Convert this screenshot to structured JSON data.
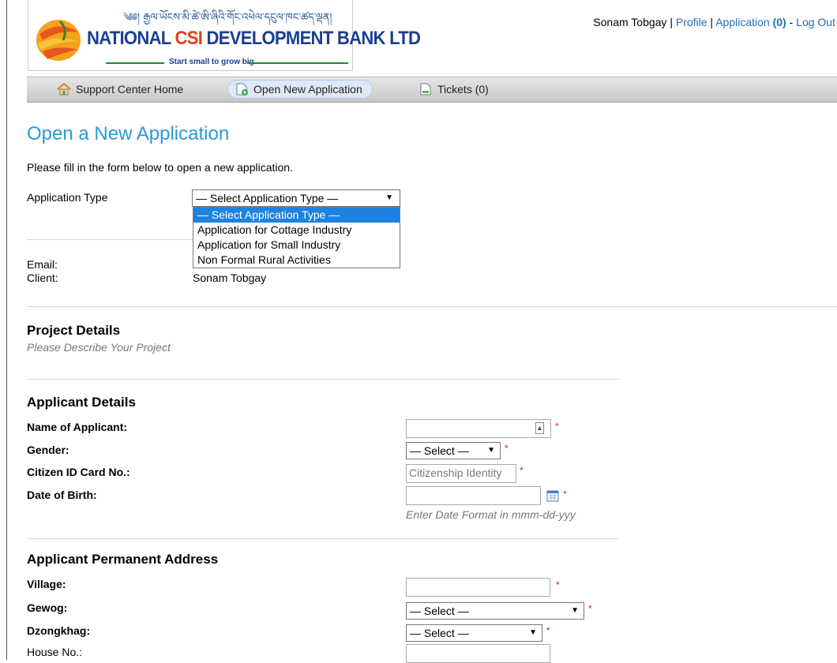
{
  "header": {
    "logo_tibetan": "༄༅། རྒྱལ་ཡོངས་མི་ཚེ་ཨི་ཞིའི་གོང་འཕེལ་དངུལ་ཁང་ཚད་ལྡན།",
    "logo_name_part1": "NATIONAL ",
    "logo_name_csi": "CSI",
    "logo_name_part2": " DEVELOPMENT BANK LTD",
    "logo_tagline": "Start small to grow big",
    "user_name": "Sonam Tobgay",
    "profile_link": "Profile",
    "application_link": "Application",
    "application_count": "(0)",
    "logout_link": "Log Out"
  },
  "nav": {
    "home": "Support Center Home",
    "open_new": "Open New Application",
    "tickets": "Tickets (0)"
  },
  "page": {
    "title": "Open a New Application",
    "intro": "Please fill in the form below to open a new application.",
    "application_type_label": "Application Type",
    "application_type_selected": "— Select Application Type —",
    "application_type_options": [
      "— Select Application Type —",
      "Application for Cottage Industry",
      "Application for Small Industry",
      "Non Formal Rural Activities"
    ],
    "email_label": "Email:",
    "client_label": "Client:",
    "client_value": "Sonam Tobgay"
  },
  "project": {
    "title": "Project Details",
    "subtitle": "Please Describe Your Project"
  },
  "applicant": {
    "title": "Applicant Details",
    "name_label": "Name of Applicant:",
    "gender_label": "Gender:",
    "gender_value": "— Select —",
    "cid_label": "Citizen ID Card No.:",
    "cid_placeholder": "Citizenship Identity",
    "dob_label": "Date of Birth:",
    "dob_hint": "Enter Date Format in mmm-dd-yyy"
  },
  "address": {
    "title": "Applicant Permanent Address",
    "village_label": "Village:",
    "gewog_label": "Gewog:",
    "gewog_value": "— Select —",
    "dzongkhag_label": "Dzongkhag:",
    "dzongkhag_value": "— Select —",
    "house_label": "House No.:"
  },
  "required_mark": "*",
  "colors": {
    "title_blue": "#2a9ad6",
    "link_blue": "#1e6fb7",
    "required_red": "#e0201b",
    "dropdown_highlight": "#1e82e0"
  }
}
